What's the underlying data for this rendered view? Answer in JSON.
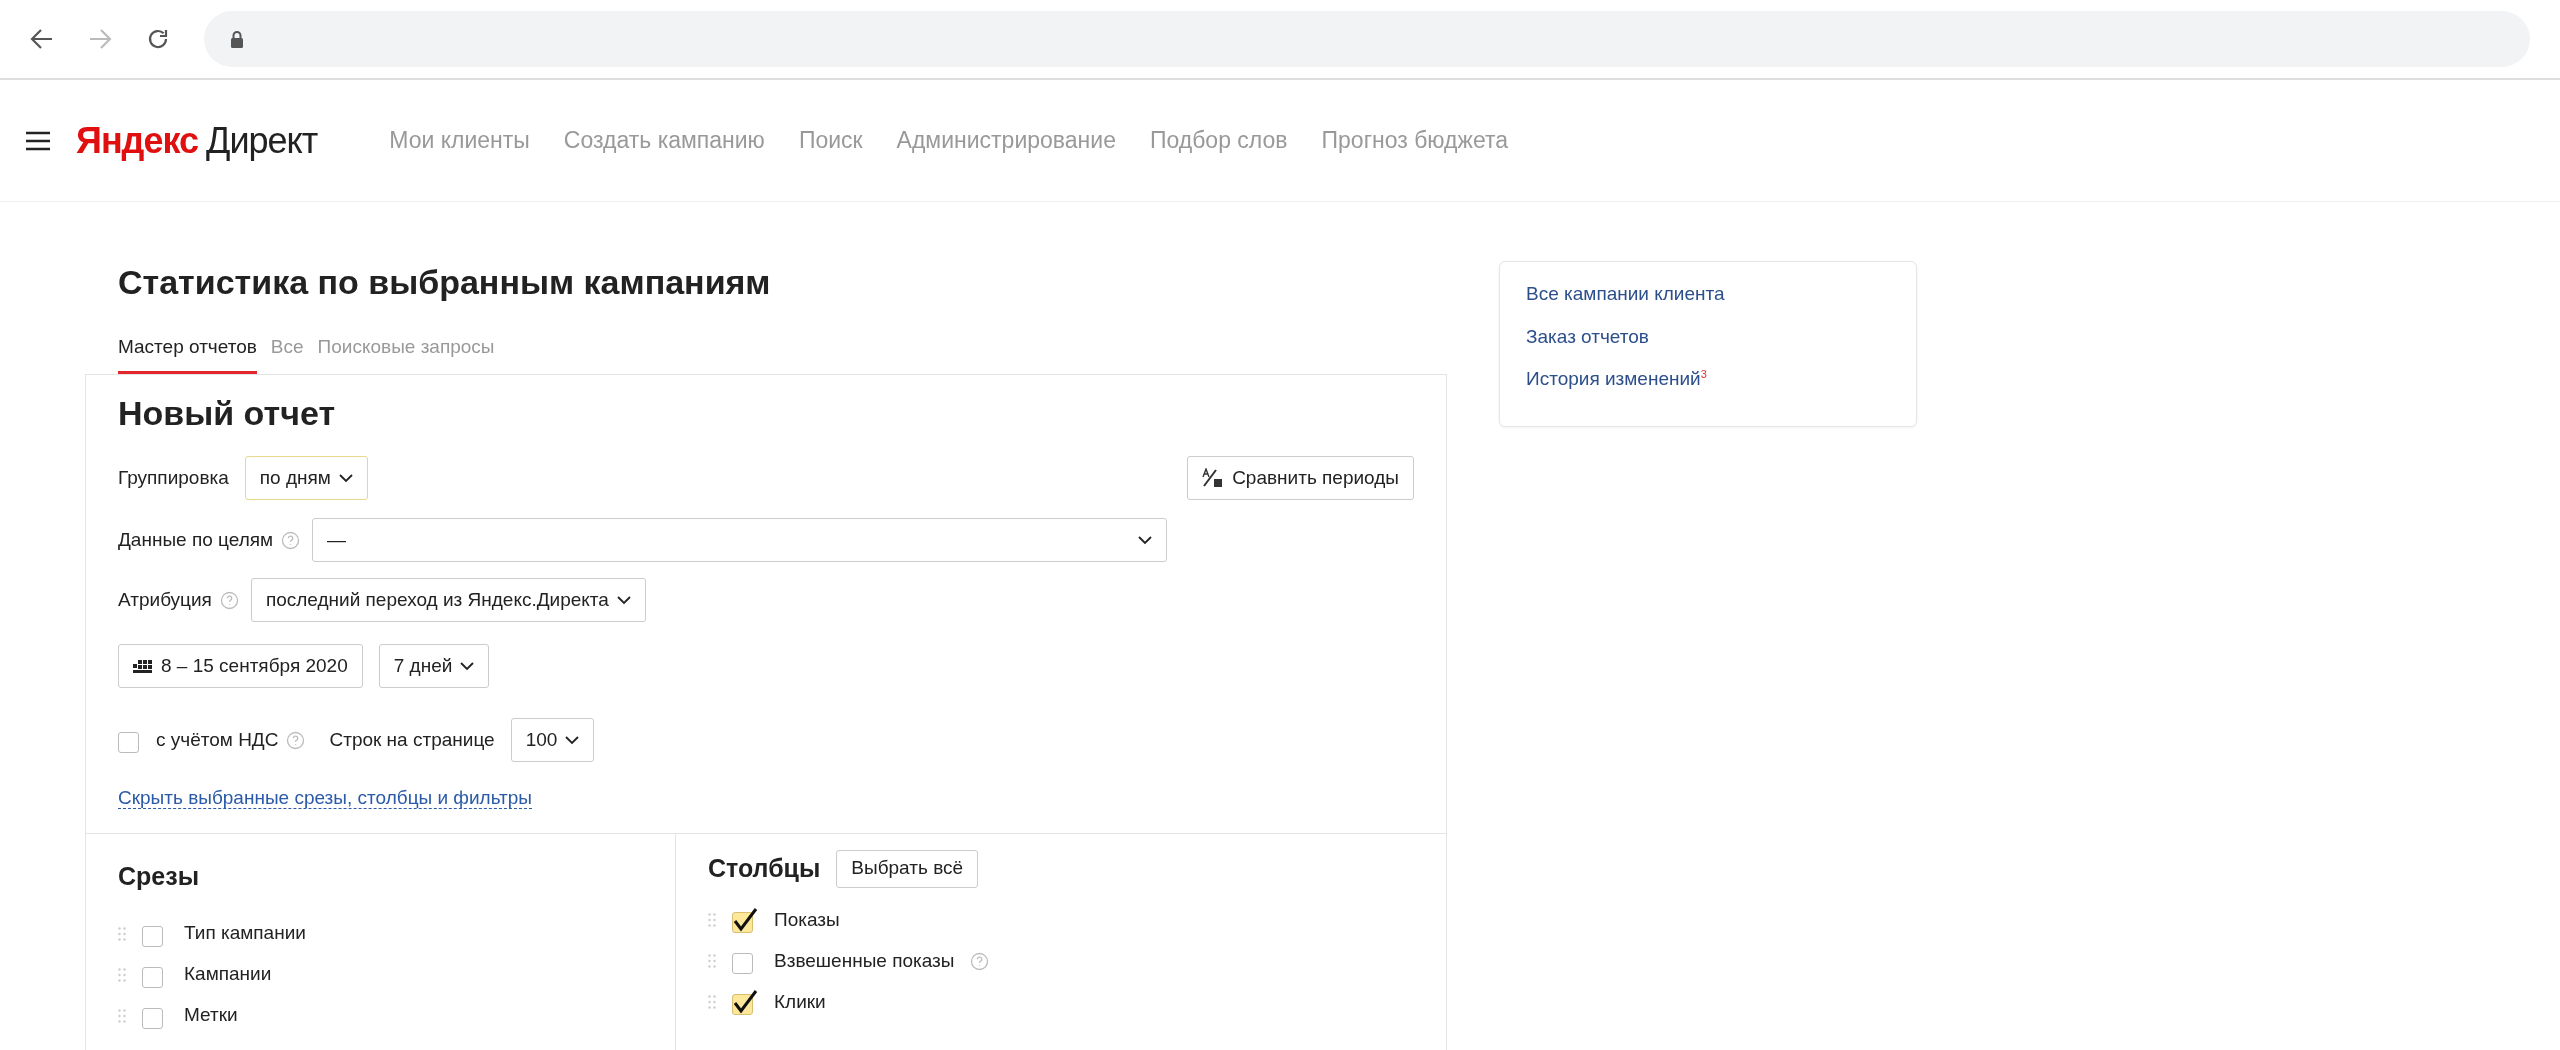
{
  "header": {
    "logo_brand": "Яндекс",
    "logo_product": "Директ",
    "nav_links": [
      "Мои клиенты",
      "Создать кампанию",
      "Поиск",
      "Администрирование",
      "Подбор слов",
      "Прогноз бюджета"
    ]
  },
  "page_title": "Статистика по выбранным кампаниям",
  "tabs": [
    {
      "label": "Мастер отчетов",
      "selected": true
    },
    {
      "label": "Все",
      "selected": false
    },
    {
      "label": "Поисковые запросы",
      "selected": false
    }
  ],
  "report": {
    "title": "Новый отчет",
    "grouping": {
      "label": "Группировка",
      "value": "по дням"
    },
    "compare_button": "Сравнить периоды",
    "goals": {
      "label": "Данные по целям",
      "value": "—"
    },
    "attribution": {
      "label": "Атрибуция",
      "value": "последний переход из Яндекс.Директа"
    },
    "date_range": "8 – 15 сентября 2020",
    "period": "7 дней",
    "vat": {
      "label": "с учётом НДС",
      "checked": false
    },
    "rows_per_page": {
      "label": "Строк на странице",
      "value": "100"
    },
    "hide_link": "Скрыть выбранные срезы, столбцы и фильтры",
    "slices": {
      "title": "Срезы",
      "items": [
        {
          "label": "Тип кампании",
          "checked": false
        },
        {
          "label": "Кампании",
          "checked": false
        },
        {
          "label": "Метки",
          "checked": false
        }
      ]
    },
    "columns": {
      "title": "Столбцы",
      "select_all": "Выбрать всё",
      "items": [
        {
          "label": "Показы",
          "checked": true,
          "help": false
        },
        {
          "label": "Взвешенные показы",
          "checked": false,
          "help": true
        },
        {
          "label": "Клики",
          "checked": true,
          "help": false
        }
      ]
    }
  },
  "side_links": [
    {
      "label": "Все кампании клиента"
    },
    {
      "label": "Заказ отчетов"
    },
    {
      "label": "История изменений",
      "badge": "3"
    }
  ]
}
